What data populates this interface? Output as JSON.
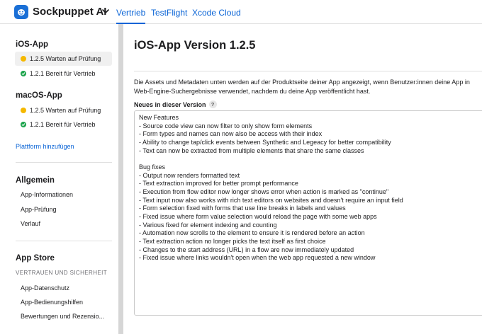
{
  "header": {
    "app_name": "Sockpuppet AI",
    "tabs": [
      {
        "label": "Vertrieb",
        "active": true
      },
      {
        "label": "TestFlight",
        "active": false
      },
      {
        "label": "Xcode Cloud",
        "active": false
      }
    ],
    "accent_color": "#0a64d6"
  },
  "sidebar": {
    "ios": {
      "title": "iOS-App",
      "items": [
        {
          "label": "1.2.5 Warten auf Prüfung",
          "status": "yellow",
          "selected": true
        },
        {
          "label": "1.2.1 Bereit für Vertrieb",
          "status": "green",
          "selected": false
        }
      ]
    },
    "macos": {
      "title": "macOS-App",
      "items": [
        {
          "label": "1.2.5 Warten auf Prüfung",
          "status": "yellow"
        },
        {
          "label": "1.2.1 Bereit für Vertrieb",
          "status": "green"
        }
      ]
    },
    "add_platform": "Plattform hinzufügen",
    "general": {
      "title": "Allgemein",
      "items": [
        "App-Informationen",
        "App-Prüfung",
        "Verlauf"
      ]
    },
    "appstore": {
      "title": "App Store",
      "subtitle": "VERTRAUEN UND SICHERHEIT",
      "items": [
        "App-Datenschutz",
        "App-Bedienungshilfen",
        "Bewertungen und Rezensio..."
      ]
    }
  },
  "main": {
    "title": "iOS-App Version 1.2.5",
    "description_line1": "Die Assets und Metadaten unten werden auf der Produktseite deiner App angezeigt, wenn Benutzer:innen deine App in",
    "description_line2": "Web-Engine-Suchergebnisse verwendet, nachdem du deine App veröffentlicht hast.",
    "notes_label": "Neues in dieser Version",
    "help_glyph": "?",
    "notes_value": "New Features\n- Source code view can now filter to only show form elements\n- Form types and names can now also be access with their index\n- Ability to change tap/click events between Synthetic and Legeacy for better compatibility\n- Text can now be extracted from multiple elements that share the same classes\n\nBug fixes\n- Output now renders formatted text\n- Text extraction improved for better prompt performance\n- Execution from flow editor now longer shows error when action is marked as \"continue\"\n- Text input now also works with rich text editors on websites and doesn't require an input field\n- Form selection fixed with forms that use line breaks in labels and values\n- Fixed issue where form value selection would reload the page with some web apps\n- Various fixed for element indexing and counting\n- Automation now scrolls to the element to ensure it is rendered before an action\n- Text extraction action no longer picks the text itself as first choice\n- Changes to the start address (URL) in a flow are now immediately updated\n- Fixed issue where links wouldn't open when the web app requested a new window"
  }
}
